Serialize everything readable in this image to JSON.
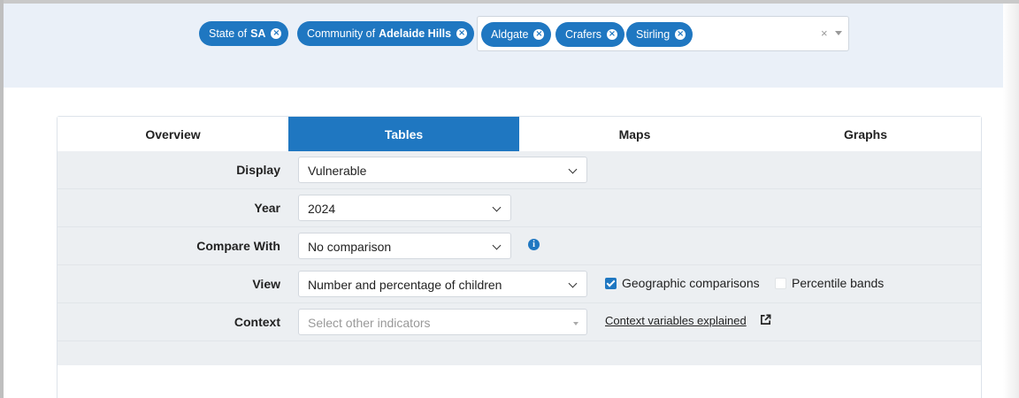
{
  "filters": {
    "chips": [
      {
        "prefix": "State of",
        "name": "SA"
      },
      {
        "prefix": "Community of",
        "name": "Adelaide Hills"
      }
    ],
    "locations": [
      "Aldgate",
      "Crafers",
      "Stirling"
    ],
    "clear_symbol": "×",
    "remove_symbol": "×"
  },
  "tabs": [
    {
      "label": "Overview",
      "active": false
    },
    {
      "label": "Tables",
      "active": true
    },
    {
      "label": "Maps",
      "active": false
    },
    {
      "label": "Graphs",
      "active": false
    }
  ],
  "form": {
    "display": {
      "label": "Display",
      "value": "Vulnerable"
    },
    "year": {
      "label": "Year",
      "value": "2024"
    },
    "compare": {
      "label": "Compare With",
      "value": "No comparison",
      "info_icon": "i"
    },
    "view": {
      "label": "View",
      "value": "Number and percentage of children"
    },
    "geo_check": {
      "label": "Geographic comparisons",
      "checked": true
    },
    "percentile_check": {
      "label": "Percentile bands",
      "checked": false
    },
    "context": {
      "label": "Context",
      "placeholder": "Select other indicators"
    },
    "context_link": "Context variables explained"
  },
  "colors": {
    "accent": "#1f77c1",
    "band": "#eaf0f8",
    "form_bg": "#eceff2"
  },
  "icons": {
    "external_link": "external-link-icon",
    "info": "info-icon",
    "chevron": "chevron-down-icon"
  }
}
